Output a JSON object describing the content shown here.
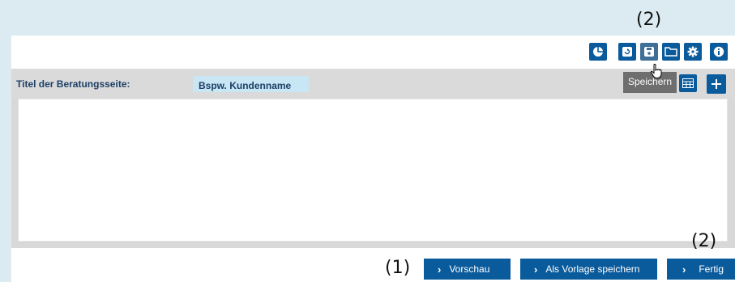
{
  "annotations": {
    "top_toolbar": "(2)",
    "fertig": "(2)",
    "vorschau": "(1)"
  },
  "header": {
    "title_label": "Titel der Beratungsseite:",
    "title_value": "Bspw. Kundenname"
  },
  "toolbar": {
    "icons": [
      "pie-chart-icon",
      "reset-icon",
      "save-icon",
      "folder-icon",
      "gear-icon",
      "info-icon"
    ],
    "tooltip": "Speichern"
  },
  "table_actions": {
    "icons": [
      "table-icon",
      "plus-icon"
    ]
  },
  "footer": {
    "preview_label": "Vorschau",
    "save_template_label": "Als Vorlage speichern",
    "done_label": "Fertig"
  },
  "colors": {
    "primary": "#0a5b9c",
    "background": "#dcebf1",
    "title_bar": "#dadada",
    "input_bg": "#c9e6f4"
  }
}
